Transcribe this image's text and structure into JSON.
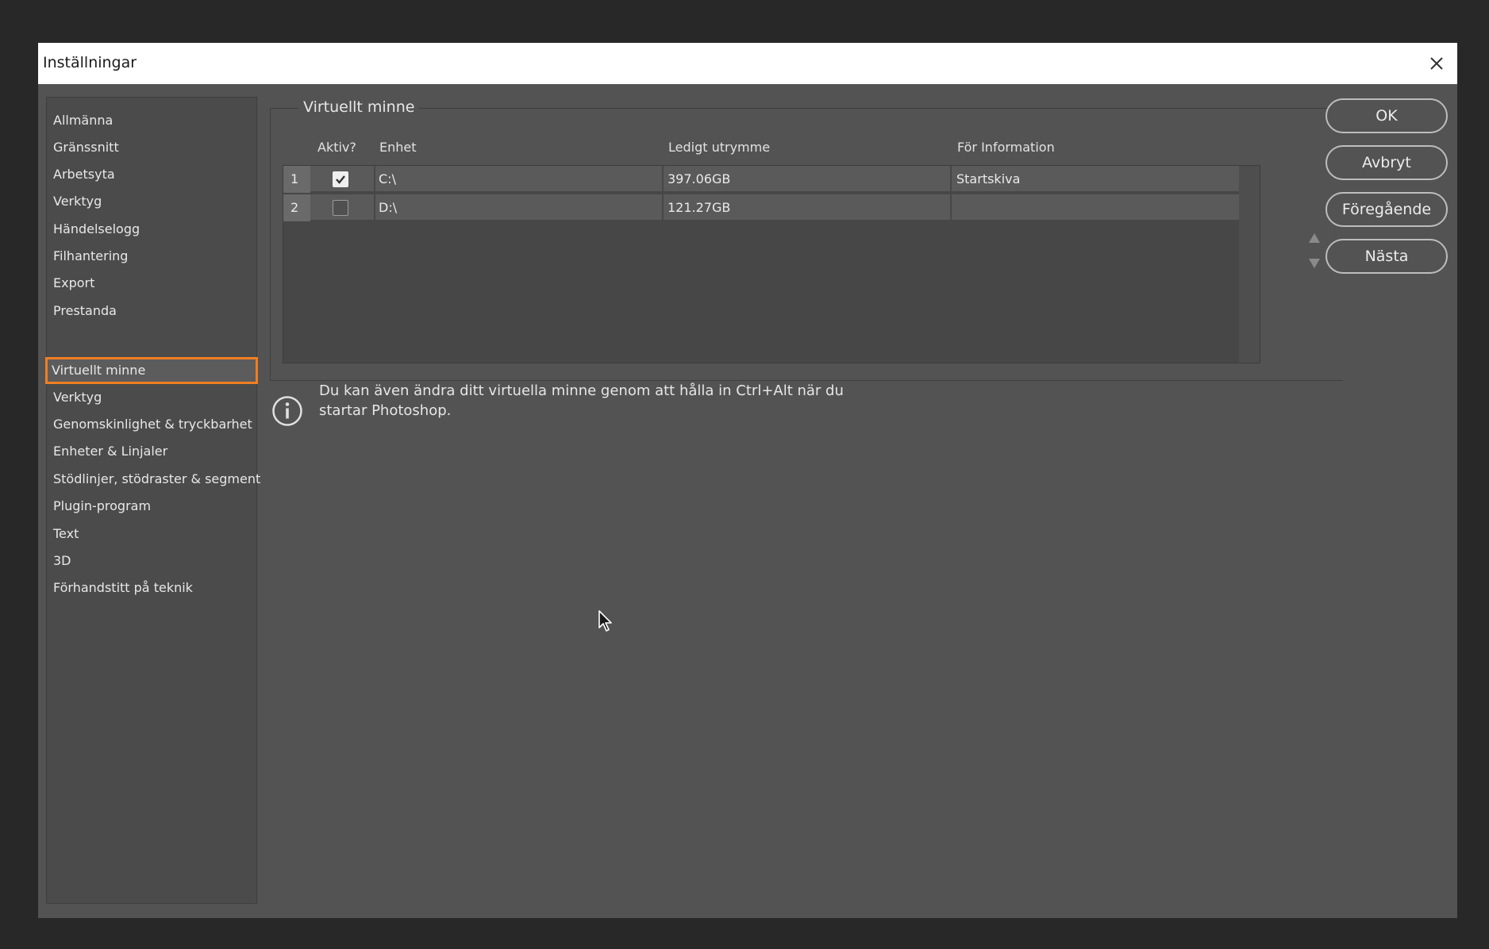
{
  "dialog": {
    "title": "Inställningar"
  },
  "sidebar": {
    "items": [
      {
        "label": "Allmänna"
      },
      {
        "label": "Gränssnitt"
      },
      {
        "label": "Arbetsyta"
      },
      {
        "label": "Verktyg"
      },
      {
        "label": "Händelselogg"
      },
      {
        "label": "Filhantering"
      },
      {
        "label": "Export"
      },
      {
        "label": "Prestanda"
      },
      {
        "label": "Virtuellt minne"
      },
      {
        "label": "Verktyg"
      },
      {
        "label": "Genomskinlighet & tryckbarhet"
      },
      {
        "label": "Enheter & Linjaler"
      },
      {
        "label": "Stödlinjer, stödraster & segment"
      },
      {
        "label": "Plugin-program"
      },
      {
        "label": "Text"
      },
      {
        "label": "3D"
      },
      {
        "label": "Förhandstitt på teknik"
      }
    ],
    "selected_index": 8,
    "selected_color": "#f07f22"
  },
  "scratch": {
    "group_title": "Virtuellt minne",
    "headers": {
      "active": "Aktiv?",
      "drive": "Enhet",
      "free_space": "Ledigt utrymme",
      "info": "För Information"
    },
    "rows": [
      {
        "num": "1",
        "active": true,
        "drive": "C:\\",
        "free_space": "397.06GB",
        "info": "Startskiva"
      },
      {
        "num": "2",
        "active": false,
        "drive": "D:\\",
        "free_space": "121.27GB",
        "info": ""
      }
    ]
  },
  "info": {
    "text": "Du kan även ändra ditt virtuella minne genom att hålla in Ctrl+Alt när du startar Photoshop."
  },
  "buttons": {
    "ok": "OK",
    "cancel": "Avbryt",
    "prev": "Föregående",
    "next": "Nästa"
  },
  "icons": {
    "close": "close-icon",
    "checkbox_checked": "checkmark-icon",
    "move_up": "triangle-up-icon",
    "move_down": "triangle-down-icon",
    "info": "info-icon",
    "cursor": "mouse-cursor-icon"
  }
}
